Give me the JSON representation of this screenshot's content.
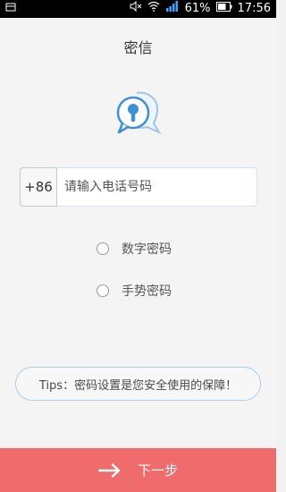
{
  "status_bar": {
    "battery_percent": "61%",
    "time": "17:56",
    "icons": [
      "notification-icon",
      "mute-icon",
      "wifi-icon",
      "signal-icon",
      "battery-icon"
    ]
  },
  "header": {
    "title": "密信"
  },
  "logo": {
    "icon": "keyhole-chat-icon"
  },
  "phone": {
    "country_code": "+86",
    "placeholder": "请输入电话号码",
    "value": ""
  },
  "options": [
    {
      "label": "数字密码",
      "selected": false
    },
    {
      "label": "手势密码",
      "selected": false
    }
  ],
  "tips": {
    "text": "Tips：密码设置是您安全使用的保障！"
  },
  "next": {
    "label": "下一步",
    "icon": "arrow-right-icon"
  },
  "colors": {
    "accent": "#f06b6b",
    "logo_blue": "#3d8fd6",
    "tips_border": "#a9cdef"
  }
}
